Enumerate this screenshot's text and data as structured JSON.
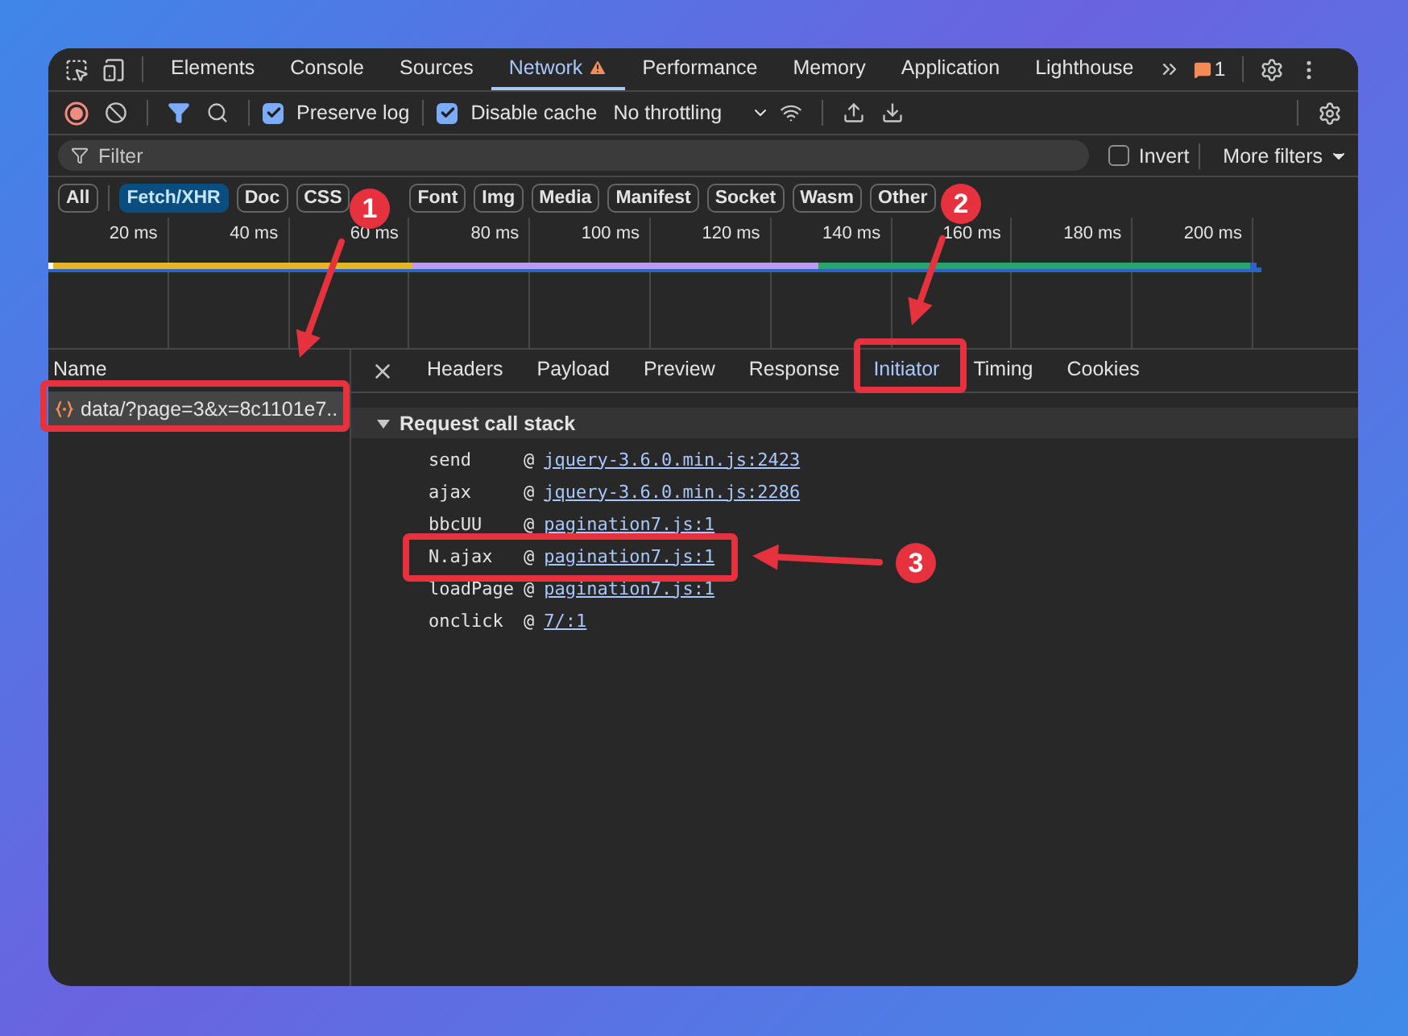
{
  "tabs": [
    {
      "label": "Elements",
      "selected": false,
      "warning": false
    },
    {
      "label": "Console",
      "selected": false,
      "warning": false
    },
    {
      "label": "Sources",
      "selected": false,
      "warning": false
    },
    {
      "label": "Network",
      "selected": true,
      "warning": true
    },
    {
      "label": "Performance",
      "selected": false,
      "warning": false
    },
    {
      "label": "Memory",
      "selected": false,
      "warning": false
    },
    {
      "label": "Application",
      "selected": false,
      "warning": false
    },
    {
      "label": "Lighthouse",
      "selected": false,
      "warning": false
    }
  ],
  "issues_count": "1",
  "toolbar": {
    "preserve_log": {
      "label": "Preserve log",
      "checked": true
    },
    "disable_cache": {
      "label": "Disable cache",
      "checked": true
    },
    "throttling": "No throttling"
  },
  "filter": {
    "placeholder": "Filter",
    "invert": {
      "label": "Invert",
      "checked": false
    },
    "more_filters": "More filters"
  },
  "type_filters": [
    {
      "label": "All",
      "selected": false
    },
    {
      "label": "Fetch/XHR",
      "selected": true
    },
    {
      "label": "Doc",
      "selected": false
    },
    {
      "label": "CSS",
      "selected": false
    },
    {
      "label": "Font",
      "selected": false
    },
    {
      "label": "Img",
      "selected": false
    },
    {
      "label": "Media",
      "selected": false
    },
    {
      "label": "Manifest",
      "selected": false
    },
    {
      "label": "Socket",
      "selected": false
    },
    {
      "label": "Wasm",
      "selected": false
    },
    {
      "label": "Other",
      "selected": false
    }
  ],
  "timeline": {
    "ticks": [
      "20 ms",
      "40 ms",
      "60 ms",
      "80 ms",
      "100 ms",
      "120 ms",
      "140 ms",
      "160 ms",
      "180 ms",
      "200 ms"
    ]
  },
  "requests": {
    "header": "Name",
    "rows": [
      {
        "name": "data/?page=3&x=8c1101e7..",
        "selected": true
      }
    ]
  },
  "detail_tabs": [
    {
      "label": "Headers",
      "selected": false
    },
    {
      "label": "Payload",
      "selected": false
    },
    {
      "label": "Preview",
      "selected": false
    },
    {
      "label": "Response",
      "selected": false
    },
    {
      "label": "Initiator",
      "selected": true
    },
    {
      "label": "Timing",
      "selected": false
    },
    {
      "label": "Cookies",
      "selected": false
    }
  ],
  "call_stack": {
    "title": "Request call stack",
    "expanded": true,
    "frames": [
      {
        "function": "send",
        "at": "@",
        "location": "jquery-3.6.0.min.js:2423"
      },
      {
        "function": "ajax",
        "at": "@",
        "location": "jquery-3.6.0.min.js:2286"
      },
      {
        "function": "bbcUU",
        "at": "@",
        "location": "pagination7.js:1"
      },
      {
        "function": "N.ajax",
        "at": "@",
        "location": "pagination7.js:1"
      },
      {
        "function": "loadPage",
        "at": "@",
        "location": "pagination7.js:1"
      },
      {
        "function": "onclick",
        "at": "@",
        "location": "7/:1"
      }
    ]
  },
  "annotations": [
    {
      "label": "1"
    },
    {
      "label": "2"
    },
    {
      "label": "3"
    }
  ]
}
